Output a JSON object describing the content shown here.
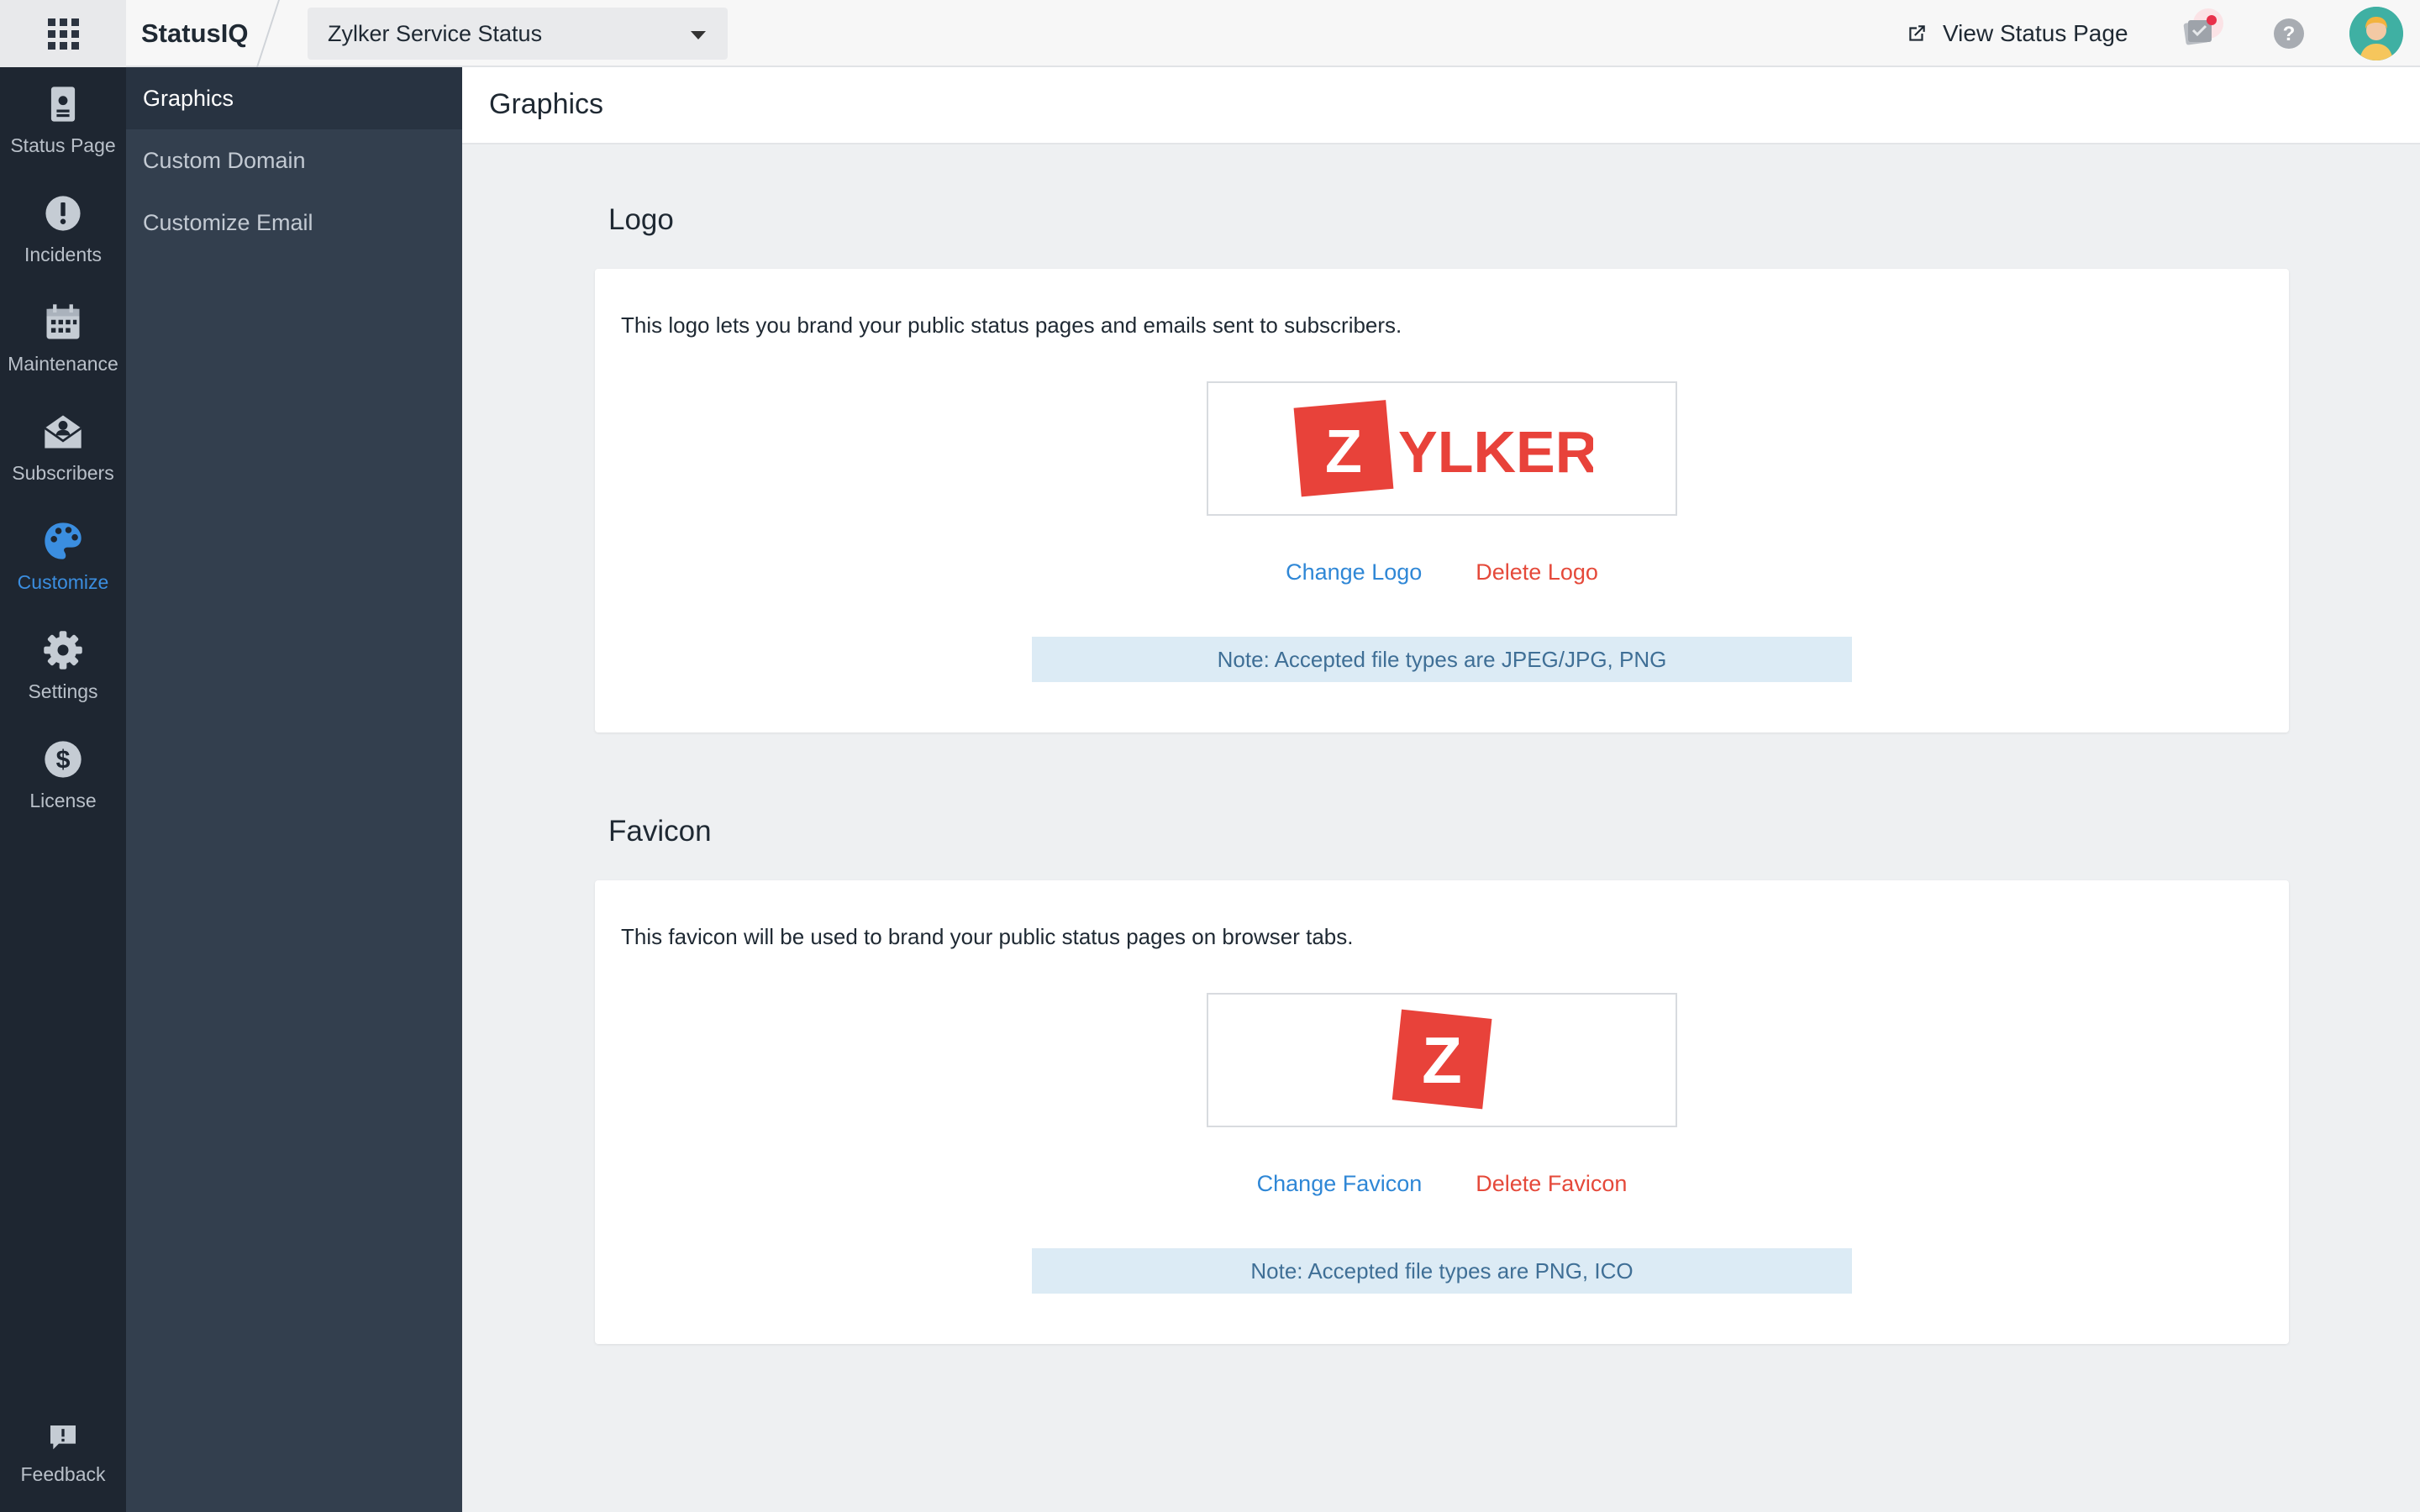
{
  "topbar": {
    "brand": "StatusIQ",
    "project": "Zylker Service Status",
    "view_status_label": "View Status Page"
  },
  "rail": {
    "items": [
      {
        "label": "Status Page",
        "icon": "status-page-icon"
      },
      {
        "label": "Incidents",
        "icon": "incidents-icon"
      },
      {
        "label": "Maintenance",
        "icon": "calendar-icon"
      },
      {
        "label": "Subscribers",
        "icon": "subscribers-icon"
      },
      {
        "label": "Customize",
        "icon": "palette-icon",
        "active": true
      },
      {
        "label": "Settings",
        "icon": "gear-icon"
      },
      {
        "label": "License",
        "icon": "dollar-icon"
      }
    ],
    "feedback_label": "Feedback"
  },
  "subnav": {
    "items": [
      {
        "label": "Graphics",
        "active": true
      },
      {
        "label": "Custom Domain"
      },
      {
        "label": "Customize Email"
      }
    ]
  },
  "page": {
    "title": "Graphics"
  },
  "logo_section": {
    "title": "Logo",
    "description": "This logo lets you brand your public status pages and emails sent to subscribers.",
    "logo_letter": "Z",
    "logo_text": "YLKER",
    "change_label": "Change Logo",
    "delete_label": "Delete Logo",
    "note": "Note: Accepted file types are JPEG/JPG, PNG"
  },
  "favicon_section": {
    "title": "Favicon",
    "description": "This favicon will be used to brand your public status pages on browser tabs.",
    "favicon_letter": "Z",
    "change_label": "Change Favicon",
    "delete_label": "Delete Favicon",
    "note": "Note: Accepted file types are PNG, ICO"
  },
  "colors": {
    "brand_red": "#e8423a",
    "link_blue": "#2f87d6",
    "delete_red": "#e5493a",
    "active_blue": "#3b8ee0",
    "notification_dot": "#e8304a"
  }
}
